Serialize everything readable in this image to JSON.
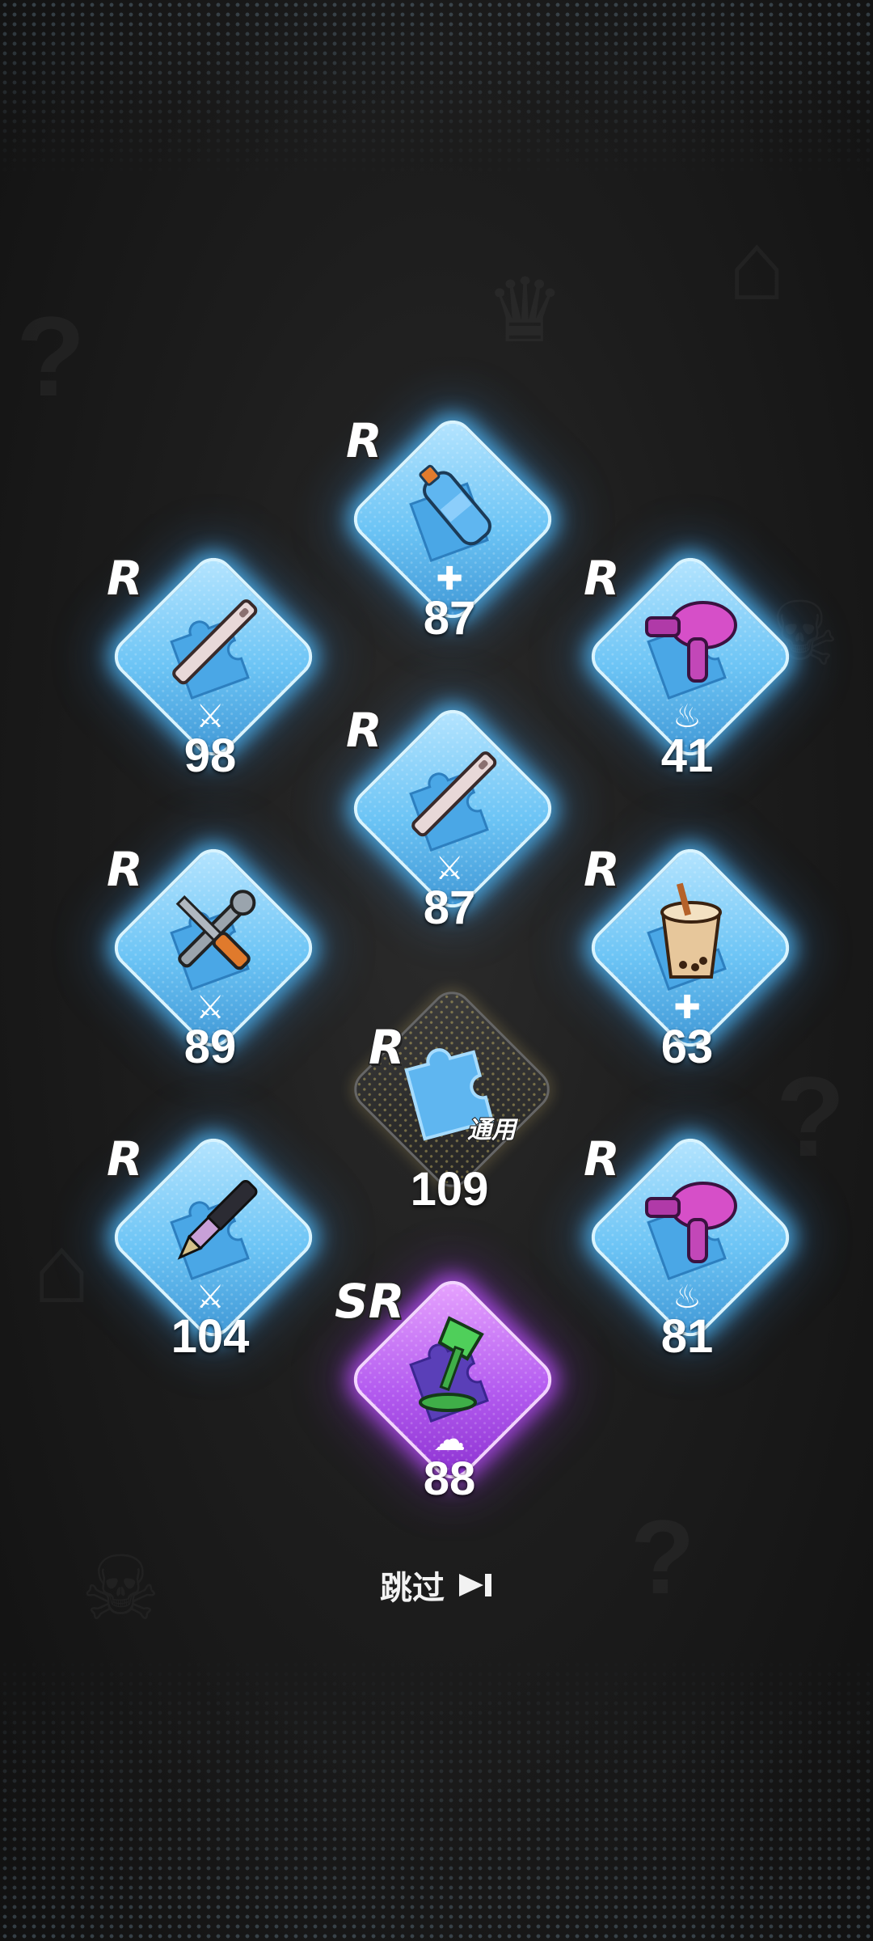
{
  "cards": [
    {
      "id": "water-bottle",
      "rarity": "R",
      "count": "87",
      "stat": "plus",
      "item": "water-bottle"
    },
    {
      "id": "ruler-1",
      "rarity": "R",
      "count": "98",
      "stat": "sword",
      "item": "ruler"
    },
    {
      "id": "hair-dryer-1",
      "rarity": "R",
      "count": "41",
      "stat": "flame",
      "item": "hair-dryer"
    },
    {
      "id": "ruler-2",
      "rarity": "R",
      "count": "87",
      "stat": "sword",
      "item": "ruler"
    },
    {
      "id": "wrench-screwdriver",
      "rarity": "R",
      "count": "89",
      "stat": "sword",
      "item": "wrench-screwdriver"
    },
    {
      "id": "bubble-tea",
      "rarity": "R",
      "count": "63",
      "stat": "plus",
      "item": "bubble-tea"
    },
    {
      "id": "generic-fragment",
      "rarity": "R",
      "count": "109",
      "stat": "none",
      "item": "generic",
      "tag": "通用"
    },
    {
      "id": "fountain-pen",
      "rarity": "R",
      "count": "104",
      "stat": "sword",
      "item": "fountain-pen"
    },
    {
      "id": "hair-dryer-2",
      "rarity": "R",
      "count": "81",
      "stat": "flame",
      "item": "hair-dryer"
    },
    {
      "id": "desk-lamp",
      "rarity": "SR",
      "count": "88",
      "stat": "speech",
      "item": "desk-lamp"
    }
  ],
  "skip": {
    "label": "跳过"
  },
  "colors": {
    "r_tile": "#6cc4f5",
    "sr_tile": "#b45cf0",
    "glow_blue": "#50beff",
    "glow_purple": "#be50ff"
  }
}
